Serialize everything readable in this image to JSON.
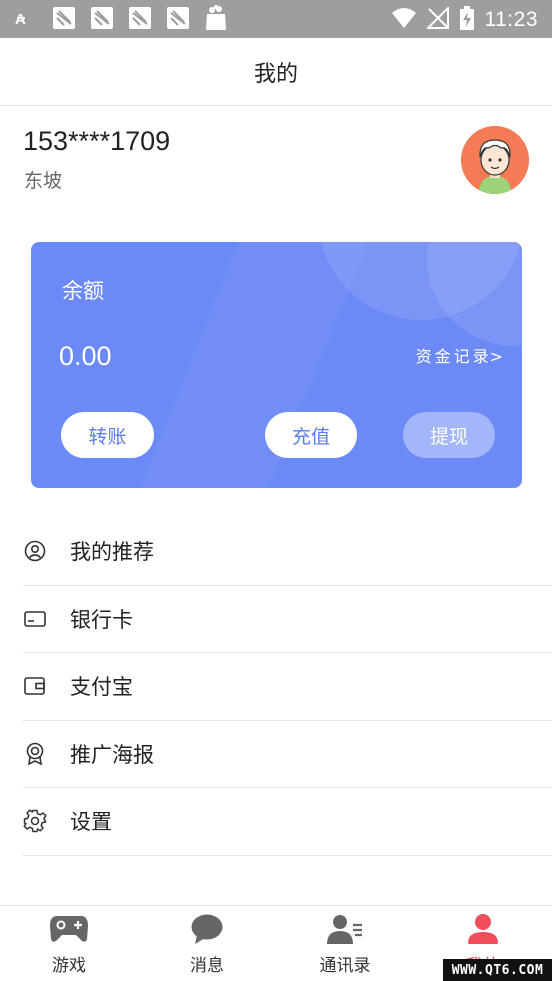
{
  "status_bar": {
    "time": "11:23"
  },
  "header": {
    "title": "我的"
  },
  "profile": {
    "phone": "153****1709",
    "nickname": "东坡"
  },
  "wallet": {
    "balance_label": "余额",
    "balance_value": "0.00",
    "records_label": "资金记录",
    "records_arrow": ">",
    "transfer_label": "转账",
    "recharge_label": "充值",
    "withdraw_label": "提现",
    "card_color": "#6b8af5"
  },
  "menu": {
    "items": [
      {
        "label": "我的推荐",
        "icon": "user-circle-icon"
      },
      {
        "label": "银行卡",
        "icon": "bank-card-icon"
      },
      {
        "label": "支付宝",
        "icon": "wallet-icon"
      },
      {
        "label": "推广海报",
        "icon": "award-badge-icon"
      },
      {
        "label": "设置",
        "icon": "gear-icon"
      }
    ]
  },
  "tabbar": {
    "active_color": "#f04e5a",
    "tabs": [
      {
        "label": "游戏",
        "icon": "gamepad-icon"
      },
      {
        "label": "消息",
        "icon": "chat-bubble-icon"
      },
      {
        "label": "通讯录",
        "icon": "contacts-icon"
      },
      {
        "label": "我的",
        "icon": "person-icon"
      }
    ]
  },
  "watermark": {
    "text": "WWW.QT6.COM"
  }
}
